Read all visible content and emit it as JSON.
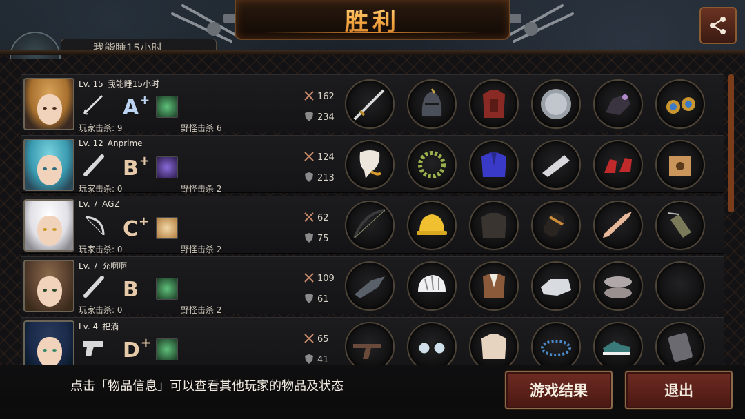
{
  "header": {
    "title": "胜利"
  },
  "player_tab": {
    "text": "我能睡15小时"
  },
  "rows": [
    {
      "level": "Lv. 15",
      "name": "我能睡15小时",
      "weapon_icon": "rapier-icon",
      "grade": "A",
      "grade_plus": "+",
      "skill_icon": "skill-green-icon",
      "player_kills": "玩家击杀: 9",
      "monster_kills": "野怪击杀 6",
      "attack": "162",
      "defense": "234",
      "items": [
        "sword-icon",
        "knight-helmet-icon",
        "red-armor-icon",
        "round-shield-icon",
        "dark-gauntlet-icon",
        "gold-earrings-icon"
      ]
    },
    {
      "level": "Lv. 12",
      "name": "Anprime",
      "weapon_icon": "bat-icon",
      "grade": "B",
      "grade_plus": "+",
      "skill_icon": "skill-purple-icon",
      "player_kills": "玩家击杀: 0",
      "monster_kills": "野怪击杀 2",
      "attack": "124",
      "defense": "213",
      "items": [
        "mask-icon",
        "laurel-wreath-icon",
        "blue-robe-icon",
        "arm-guard-icon",
        "red-heels-icon",
        "cardboard-box-icon"
      ]
    },
    {
      "level": "Lv. 7",
      "name": "AGZ",
      "weapon_icon": "bow-icon",
      "grade": "C",
      "grade_plus": "+",
      "skill_icon": "skill-gold-icon",
      "player_kills": "玩家击杀: 0",
      "monster_kills": "野怪击杀 2",
      "attack": "62",
      "defense": "75",
      "items": [
        "longbow-icon",
        "hard-hat-icon",
        "leather-jacket-icon",
        "bracer-icon",
        "prosthetic-leg-icon",
        "quiver-icon"
      ]
    },
    {
      "level": "Lv. 7",
      "name": "允啊啊",
      "weapon_icon": "bat-icon",
      "grade": "B",
      "grade_plus": "",
      "skill_icon": "skill-green-icon",
      "player_kills": "玩家击杀: 0",
      "monster_kills": "野怪击杀 2",
      "attack": "109",
      "defense": "61",
      "items": [
        "bird-head-icon",
        "bike-helmet-icon",
        "vest-icon",
        "glove-icon",
        "slippers-icon",
        "empty-slot-icon"
      ]
    },
    {
      "level": "Lv. 4",
      "name": "祀淌",
      "weapon_icon": "pistol-icon",
      "grade": "D",
      "grade_plus": "+",
      "skill_icon": "skill-green-icon",
      "player_kills": "",
      "monster_kills": "",
      "attack": "65",
      "defense": "41",
      "items": [
        "flintlock-icon",
        "glasses-icon",
        "shirt-icon",
        "bead-bracelet-icon",
        "sneakers-icon",
        "leg-armor-icon"
      ]
    }
  ],
  "footer": {
    "hint": "点击「物品信息」可以查看其他玩家的物品及状态",
    "result_button": "游戏结果",
    "exit_button": "退出"
  },
  "colors": {
    "grade": "#e6c9a8",
    "accent": "#f0a33a",
    "button": "#6e2b22"
  }
}
